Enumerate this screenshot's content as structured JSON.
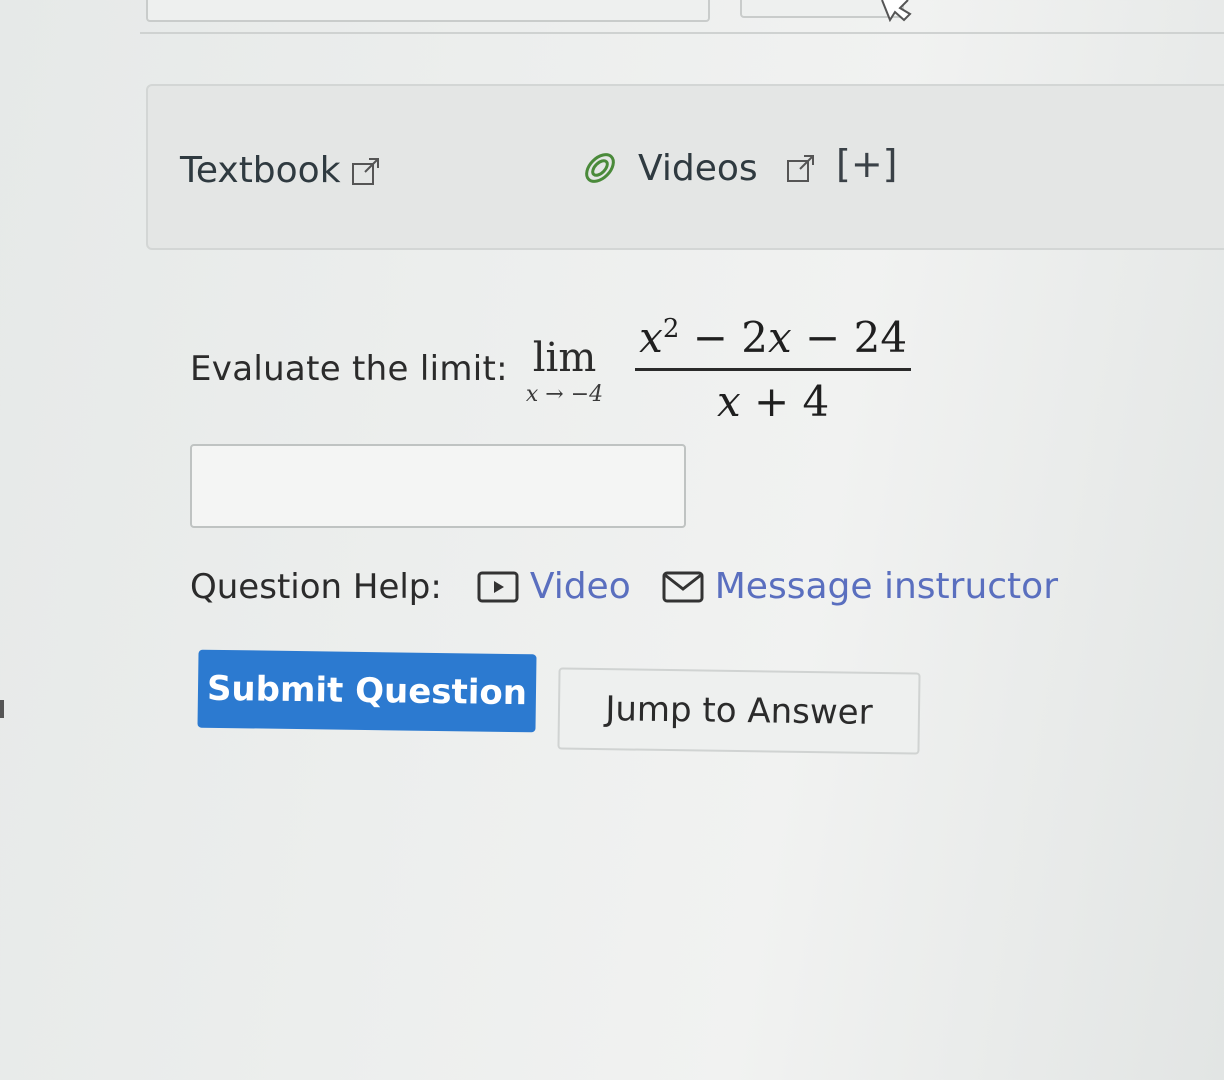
{
  "resources": {
    "textbook_label": "Textbook",
    "videos_label": "Videos",
    "expand_label": "[+]"
  },
  "question": {
    "prompt": "Evaluate the limit:",
    "lim_word": "lim",
    "lim_subscript": "x → −4",
    "numerator_var": "x",
    "numerator_exp": "2",
    "numerator_rest": " − 2",
    "numerator_var2": "x",
    "numerator_tail": " − 24",
    "denominator_var": "x",
    "denominator_rest": " + 4"
  },
  "answer": {
    "value": "",
    "placeholder": ""
  },
  "help": {
    "label": "Question Help:",
    "video_label": "Video",
    "message_label": "Message instructor"
  },
  "buttons": {
    "submit_label": "Submit Question",
    "jump_label": "Jump to Answer"
  },
  "colors": {
    "link": "#5a6fbf",
    "submit_bg": "#2c7ad0"
  }
}
